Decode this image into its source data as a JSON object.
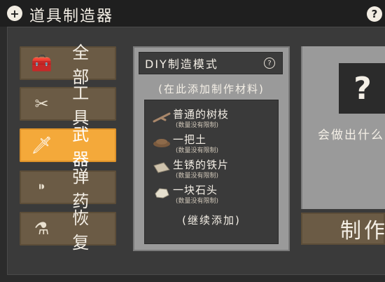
{
  "header": {
    "title": "道具制造器",
    "add_icon": "plus-circle-icon",
    "help_icon": "question-icon"
  },
  "categories": [
    {
      "label": "全部",
      "icon": "toolbox-icon",
      "active": false
    },
    {
      "label": "工具",
      "icon": "scissors-icon",
      "active": false
    },
    {
      "label": "武器",
      "icon": "knife-icon",
      "active": true
    },
    {
      "label": "弹药",
      "icon": "bullet-icon",
      "active": false
    },
    {
      "label": "恢复",
      "icon": "bottle-icon",
      "active": false
    }
  ],
  "diy": {
    "title": "DIY制造模式",
    "subtitle": "(在此添加制作材料)",
    "materials": [
      {
        "name": "普通的树枝",
        "note": "(数量没有限制)",
        "icon": "stick-icon"
      },
      {
        "name": "一把土",
        "note": "(数量没有限制)",
        "icon": "dirt-icon"
      },
      {
        "name": "生锈的铁片",
        "note": "(数量没有限制)",
        "icon": "iron-plate-icon"
      },
      {
        "name": "一块石头",
        "note": "(数量没有限制)",
        "icon": "stone-icon"
      }
    ],
    "more": "(继续添加)"
  },
  "result": {
    "unknown": "?",
    "text": "会做出什么",
    "make_button": "制作"
  },
  "colors": {
    "accent": "#f4a93a",
    "category_bg": "#6b5b45",
    "panel_bg": "#9a9a9a",
    "dark_bg": "#3a3a3a"
  }
}
